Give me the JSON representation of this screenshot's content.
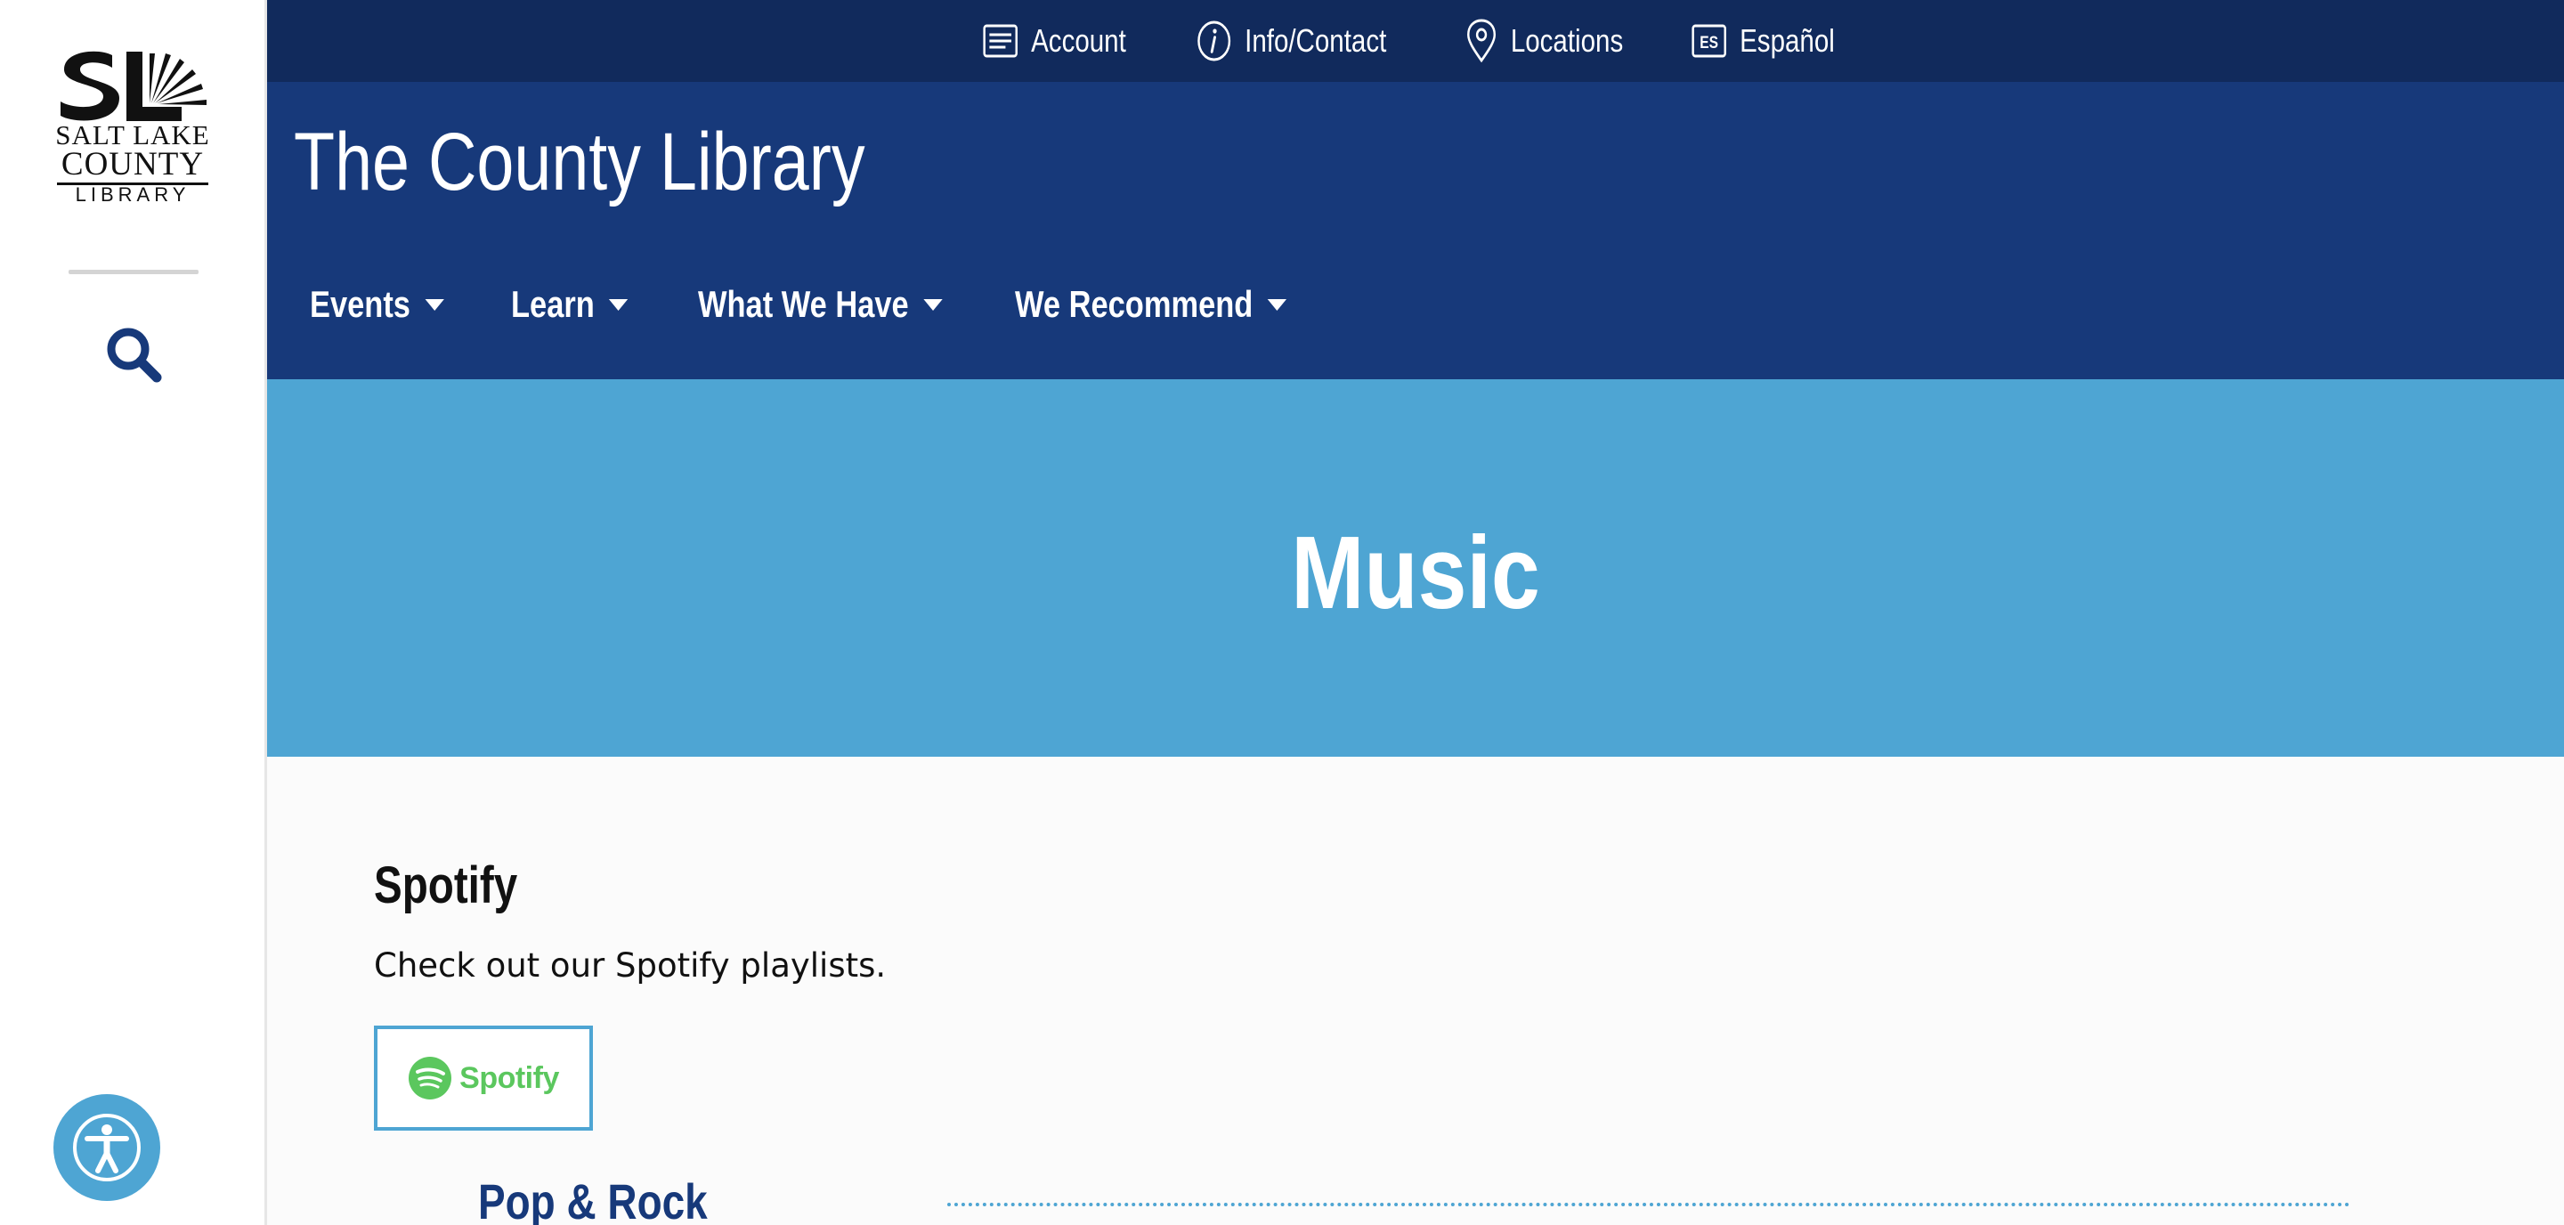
{
  "sidebar": {
    "logo": {
      "line1": "SALT LAKE",
      "line2": "COUNTY",
      "line3": "LIBRARY"
    },
    "search_icon": "search-icon",
    "accessibility_icon": "accessibility-icon"
  },
  "utility": {
    "items": [
      {
        "label": "Account",
        "icon": "card-icon"
      },
      {
        "label": "Info/Contact",
        "icon": "info-icon"
      },
      {
        "label": "Locations",
        "icon": "map-pin-icon"
      },
      {
        "label": "Español",
        "icon": "language-es-icon",
        "badge": "ES"
      }
    ]
  },
  "header": {
    "title": "The County Library",
    "nav": [
      {
        "label": "Events"
      },
      {
        "label": "Learn"
      },
      {
        "label": "What We Have"
      },
      {
        "label": "We Recommend"
      }
    ]
  },
  "hero": {
    "title": "Music"
  },
  "content": {
    "heading": "Spotify",
    "text": "Check out our Spotify playlists.",
    "spotify_label": "Spotify",
    "subheading": "Pop & Rock"
  },
  "colors": {
    "utility_bg": "#112a5c",
    "header_bg": "#17397a",
    "hero_bg": "#4ea5d3",
    "spotify_green": "#5bc75e",
    "accent": "#4ea5d3"
  }
}
